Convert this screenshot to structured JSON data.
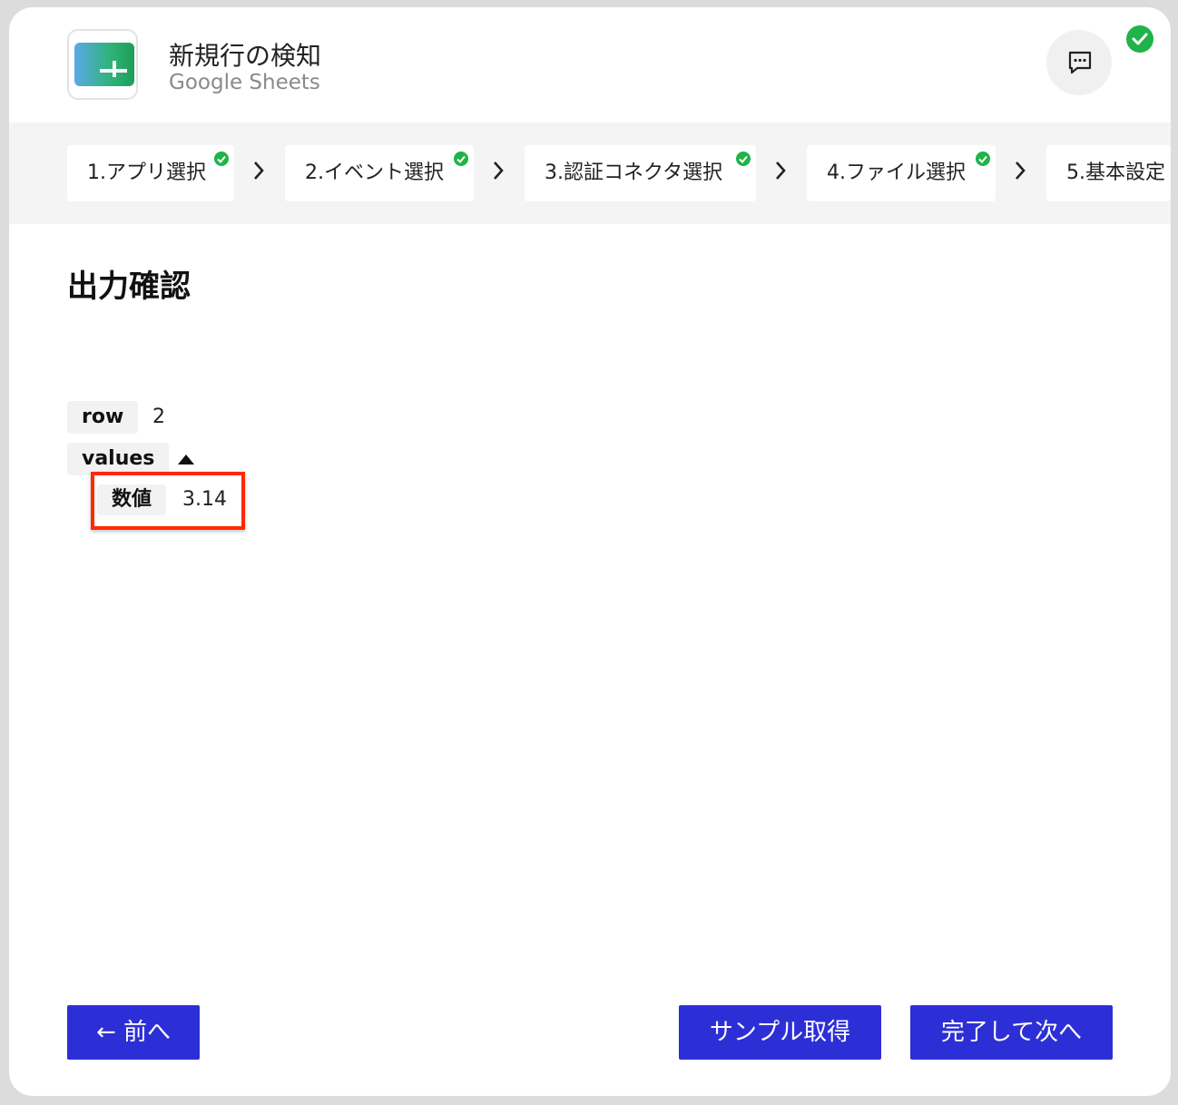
{
  "header": {
    "title": "新規行の検知",
    "subtitle": "Google Sheets",
    "app_icon": "google-sheets-icon",
    "chat_icon": "chat-bubble-icon",
    "status_icon": "check-circle-icon"
  },
  "steps": [
    {
      "label": "1.アプリ選択",
      "done": true
    },
    {
      "label": "2.イベント選択",
      "done": true
    },
    {
      "label": "3.認証コネクタ選択",
      "done": true
    },
    {
      "label": "4.ファイル選択",
      "done": true
    },
    {
      "label": "5.基本設定",
      "done": false
    }
  ],
  "content": {
    "heading": "出力確認",
    "fields": [
      {
        "key": "row",
        "value": "2"
      },
      {
        "key": "values",
        "value": ""
      }
    ],
    "nested": [
      {
        "key": "数値",
        "value": "3.14"
      }
    ]
  },
  "footer": {
    "prev_label": "← 前へ",
    "sample_label": "サンプル取得",
    "next_label": "完了して次へ"
  },
  "colors": {
    "accent": "#2d2fd6",
    "success": "#1fb34a",
    "highlight": "#ff2a00"
  }
}
